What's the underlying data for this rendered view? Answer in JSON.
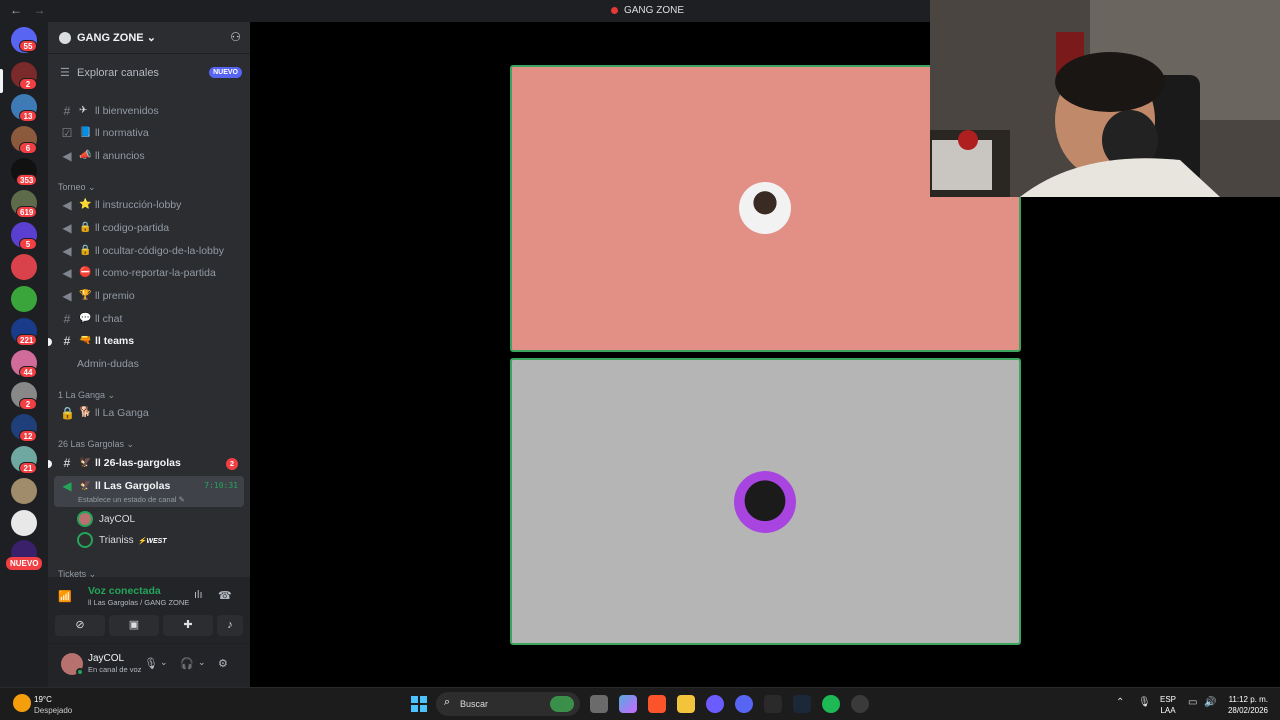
{
  "window": {
    "title": "GANG ZONE",
    "back": "←",
    "forward": "→"
  },
  "servers": [
    {
      "badge": "55"
    },
    {
      "badge": "2"
    },
    {
      "badge": "13"
    },
    {
      "badge": "6"
    },
    {
      "badge": "353"
    },
    {
      "badge": "619"
    },
    {
      "badge": "5"
    },
    {
      "badge": ""
    },
    {
      "badge": ""
    },
    {
      "badge": "221"
    },
    {
      "badge": "44"
    },
    {
      "badge": "2"
    },
    {
      "badge": "12"
    },
    {
      "badge": "21"
    },
    {
      "badge": ""
    },
    {
      "badge": ""
    }
  ],
  "servers_new_label": "NUEVO",
  "guild": {
    "name": "GANG ZONE",
    "chevron": "⌄"
  },
  "explore": {
    "label": "Explorar canales",
    "badge": "NUEVO"
  },
  "channels": {
    "top": [
      {
        "emoji": "✈",
        "label": "ll bienvenidos"
      },
      {
        "emoji": "📘",
        "label": "ll normativa"
      },
      {
        "emoji": "📣",
        "label": "ll anuncios"
      }
    ],
    "torneo_label": "Torneo",
    "torneo": [
      {
        "emoji": "⭐",
        "label": "ll instrucción-lobby"
      },
      {
        "emoji": "🔒",
        "label": "ll codigo-partida"
      },
      {
        "emoji": "🔒",
        "label": "ll ocultar-código-de-la-lobby"
      },
      {
        "emoji": "⛔",
        "label": "ll como-reportar-la-partida"
      },
      {
        "emoji": "🏆",
        "label": "ll premio"
      },
      {
        "emoji": "💬",
        "label": "ll chat"
      },
      {
        "emoji": "🔫",
        "label": "ll teams"
      },
      {
        "emoji": "",
        "label": "Admin-dudas"
      }
    ],
    "ganga_label": "1 La Ganga",
    "ganga": [
      {
        "emoji": "🐕",
        "label": "ll La Ganga"
      }
    ],
    "gargolas_label": "26 Las Gargolas",
    "gargolas_text": {
      "emoji": "🦅",
      "label": "ll 26-las-gargolas",
      "mention": "2"
    },
    "gargolas_voice": {
      "emoji": "🦅",
      "label": "ll Las Gargolas",
      "timer": "7:10:31",
      "status": "Establece un estado de canal ✎"
    },
    "voice_users": [
      {
        "name": "JayCOL",
        "tag": ""
      },
      {
        "name": "Trianiss",
        "tag": "⚡WEST"
      }
    ],
    "tickets_label": "Tickets"
  },
  "voice": {
    "status": "Voz conectada",
    "location": "ll Las Gargolas / GANG ZONE"
  },
  "user": {
    "name": "JayCOL",
    "status": "En canal de voz"
  },
  "taskbar": {
    "temperature": "19°C",
    "condition": "Despejado",
    "search_placeholder": "Buscar",
    "lang_top": "ESP",
    "lang_bottom": "LAA",
    "time": "11:12 p. m.",
    "date": "28/02/2026"
  },
  "colors": {
    "accent": "#5865f2",
    "online": "#23a559",
    "mention": "#f23f43",
    "tile_top": "#e28f85",
    "tile_bottom": "#b5b5b5",
    "speaking_border": "#3ba55d"
  }
}
